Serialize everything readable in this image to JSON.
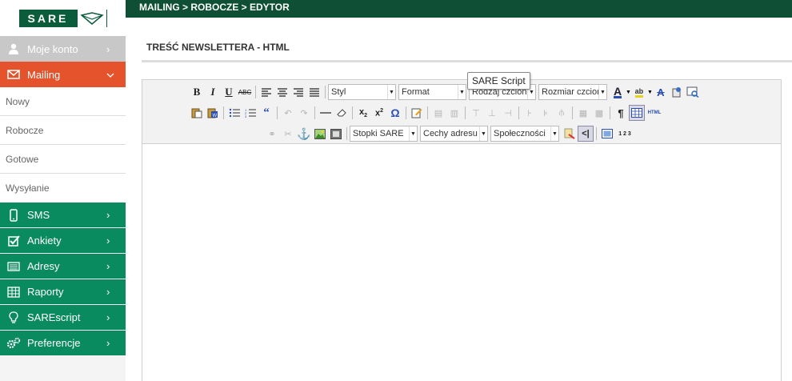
{
  "brand": {
    "logo_text": "SARE"
  },
  "sidebar": {
    "account": {
      "label": "Moje konto",
      "icon": "user-icon"
    },
    "mailing": {
      "label": "Mailing",
      "icon": "envelope-icon",
      "sub": [
        "Nowy",
        "Robocze",
        "Gotowe",
        "Wysyłanie"
      ]
    },
    "items": [
      {
        "label": "SMS",
        "icon": "phone-icon"
      },
      {
        "label": "Ankiety",
        "icon": "checkbox-icon"
      },
      {
        "label": "Adresy",
        "icon": "address-list-icon"
      },
      {
        "label": "Raporty",
        "icon": "table-icon"
      },
      {
        "label": "SAREscript",
        "icon": "lightbulb-icon"
      },
      {
        "label": "Preferencje",
        "icon": "gears-icon"
      }
    ],
    "colors": {
      "grey": "#c8c8c8",
      "orange": "#e4532b",
      "green": "#0a8a5f"
    }
  },
  "breadcrumb": "MAILING > ROBOCZE > EDYTOR",
  "section_title": "TREŚĆ NEWSLETTERA - HTML",
  "toolbar": {
    "combos": {
      "style": "Styl",
      "format": "Format",
      "font": "Rodzaj czcionk",
      "size": "Rozmiar czcion",
      "footers": "Stopki SARE",
      "address": "Cechy adresu",
      "social": "Społeczności"
    },
    "html_label": "HTML",
    "counter_label": "1 2 3"
  },
  "tooltip": "SARE Script"
}
